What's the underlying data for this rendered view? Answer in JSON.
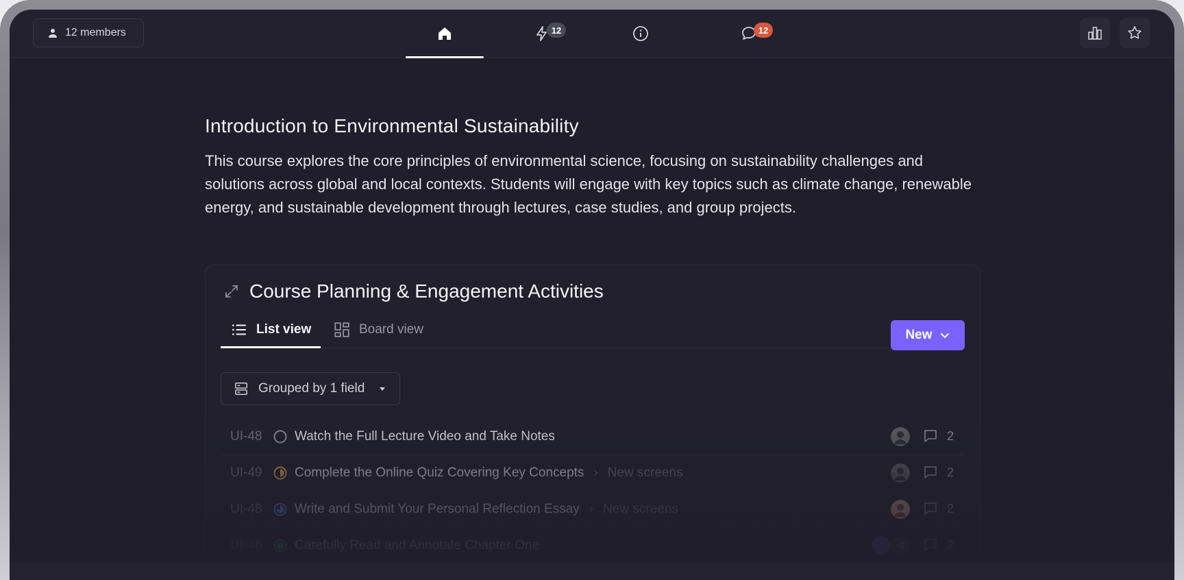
{
  "topbar": {
    "members_label": "12 members",
    "tabs": [
      {
        "name": "home",
        "badge": ""
      },
      {
        "name": "activity",
        "badge": "12"
      },
      {
        "name": "info",
        "badge": ""
      },
      {
        "name": "comments",
        "badge": "12"
      }
    ],
    "badge_colors": {
      "grey": "#4a4956",
      "red": "#d9573f"
    }
  },
  "course": {
    "title": "Introduction to Environmental Sustainability",
    "description": "This course explores the core principles of environmental science, focusing on sustainability challenges and solutions across global and local contexts. Students will engage with key topics such as climate change, renewable energy, and sustainable development through lectures, case studies, and group projects."
  },
  "card": {
    "title": "Course Planning & Engagement Activities",
    "views": {
      "list": "List view",
      "board": "Board view"
    },
    "new_label": "New",
    "group_label": "Grouped by 1 field",
    "accent": "#7b61ff",
    "rows": [
      {
        "id": "UI-48",
        "status": "todo",
        "title": "Watch the Full Lecture Video and Take Notes",
        "crumb": "",
        "comments": "2"
      },
      {
        "id": "UI-49",
        "status": "in-progress",
        "title": "Complete the Online Quiz Covering Key Concepts",
        "crumb": "New screens",
        "comments": "2"
      },
      {
        "id": "UI-48",
        "status": "in-review",
        "title": "Write and Submit Your Personal Reflection Essay",
        "crumb": "New screens",
        "comments": "2"
      },
      {
        "id": "UI-46",
        "status": "done",
        "title": "Carefully Read and Annotate Chapter One",
        "crumb": "",
        "comments": "2",
        "extra_assignees": "+2"
      }
    ]
  }
}
